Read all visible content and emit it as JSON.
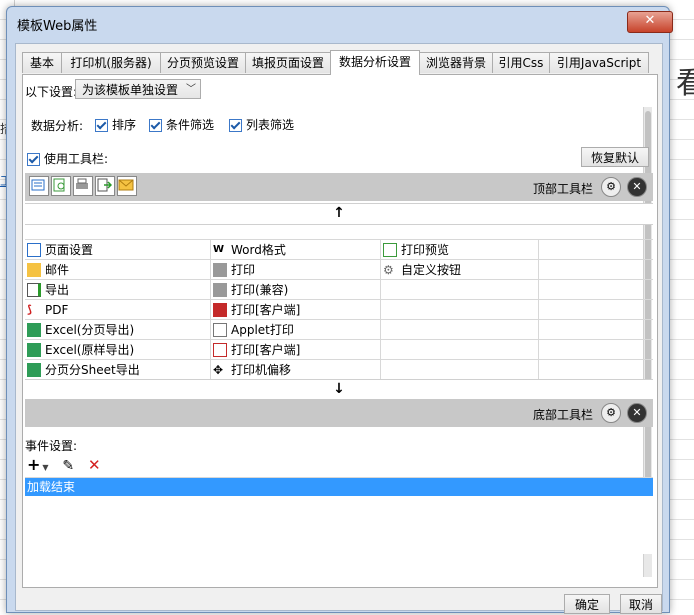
{
  "window": {
    "title": "模板Web属性",
    "close_label": "✕"
  },
  "background": {
    "big_glyph": "看",
    "side_glyph": "措",
    "side_link": "工"
  },
  "tabs": [
    {
      "label": "基本"
    },
    {
      "label": "打印机(服务器)"
    },
    {
      "label": "分页预览设置"
    },
    {
      "label": "填报页面设置"
    },
    {
      "label": "数据分析设置",
      "active": true
    },
    {
      "label": "浏览器背景"
    },
    {
      "label": "引用Css"
    },
    {
      "label": "引用JavaScript"
    }
  ],
  "settings": {
    "scope_label": "以下设置:",
    "scope_value": "为该模板单独设置",
    "analysis_label": "数据分析:",
    "sort_label": "排序",
    "filter_label": "条件筛选",
    "column_filter_label": "列表筛选",
    "use_toolbar_label": "使用工具栏:",
    "restore_default": "恢复默认"
  },
  "toolbars": {
    "top_label": "顶部工具栏",
    "bottom_label": "底部工具栏",
    "up_arrow": "↑",
    "down_arrow": "↓"
  },
  "items": {
    "col1": [
      "页面设置",
      "邮件",
      "导出",
      "PDF",
      "Excel(分页导出)",
      "Excel(原样导出)",
      "分页分Sheet导出"
    ],
    "col2": [
      "Word格式",
      "打印",
      "打印(兼容)",
      "打印[客户端]",
      "Applet打印",
      "打印[客户端]",
      "打印机偏移"
    ],
    "col3": [
      "打印预览",
      "自定义按钮"
    ]
  },
  "events": {
    "title": "事件设置:",
    "add_icon": "+",
    "list": [
      "加载结束"
    ]
  },
  "footer": {
    "ok": "确定",
    "cancel": "取消"
  },
  "colors": {
    "selection": "#3399ff",
    "toolbar_bar": "#c8c8c8",
    "dialog_frame": "#c9d9ee"
  }
}
